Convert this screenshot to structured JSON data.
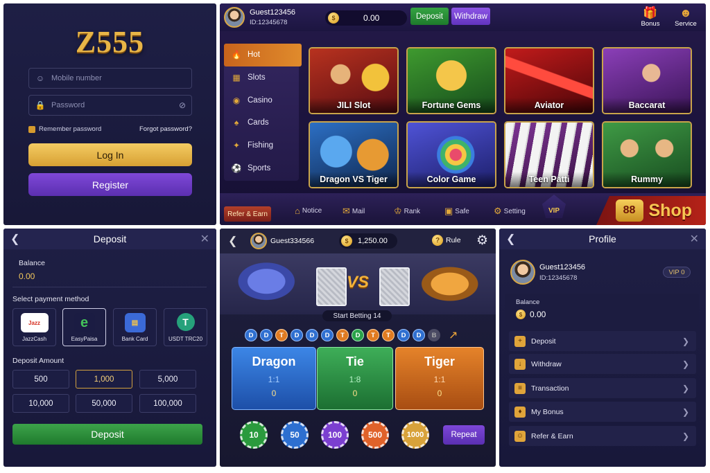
{
  "login": {
    "logo": "Z555",
    "mobile_placeholder": "Mobile number",
    "password_placeholder": "Password",
    "remember": "Remember password",
    "forgot": "Forgot password?",
    "login_btn": "Log In",
    "register_btn": "Register"
  },
  "lobby": {
    "user": {
      "name": "Guest123456",
      "id": "ID:12345678"
    },
    "balance": "0.00",
    "deposit_btn": "Deposit",
    "withdraw_btn": "Withdraw",
    "bonus": "Bonus",
    "service": "Service",
    "categories": [
      {
        "label": "Hot",
        "icon": "fire-icon"
      },
      {
        "label": "Slots",
        "icon": "slots-icon"
      },
      {
        "label": "Casino",
        "icon": "casino-icon"
      },
      {
        "label": "Cards",
        "icon": "cards-icon"
      },
      {
        "label": "Fishing",
        "icon": "fishing-icon"
      },
      {
        "label": "Sports",
        "icon": "sports-icon"
      }
    ],
    "games": [
      {
        "label": "JILI Slot",
        "color": "#8a1c1c"
      },
      {
        "label": "Fortune Gems",
        "color": "#2c6f2a"
      },
      {
        "label": "Aviator",
        "color": "#9c1313"
      },
      {
        "label": "Baccarat",
        "color": "#5b2a86"
      },
      {
        "label": "Dragon VS Tiger",
        "color": "#1f5fa5"
      },
      {
        "label": "Color Game",
        "color": "#3b3fa8"
      },
      {
        "label": "Teen Patti",
        "color": "#6b2a78"
      },
      {
        "label": "Rummy",
        "color": "#2e7a3a"
      }
    ],
    "bottom": {
      "refer": "Refer & Earn",
      "notice": "Notice",
      "mail": "Mail",
      "rank": "Rank",
      "safe": "Safe",
      "setting": "Setting",
      "vip": "VIP",
      "shop": "Shop",
      "shop_badge": "88"
    }
  },
  "deposit": {
    "title": "Deposit",
    "balance_label": "Balance",
    "balance": "0.00",
    "method_label": "Select payment method",
    "methods": [
      "JazzCash",
      "EasyPaisa",
      "Bank Card",
      "USDT TRC20"
    ],
    "amount_label": "Deposit Amount",
    "amounts": [
      "500",
      "1,000",
      "5,000",
      "10,000",
      "50,000",
      "100,000"
    ],
    "selected_amount": "1,000",
    "deposit_btn": "Deposit"
  },
  "game": {
    "user": "Guest334566",
    "balance": "1,250.00",
    "rule": "Rule",
    "vs": "VS",
    "start_betting": "Start Betting 14",
    "road": [
      "D",
      "D",
      "T",
      "D",
      "D",
      "D",
      "T",
      "D",
      "T",
      "T",
      "D",
      "D",
      "B"
    ],
    "bets": [
      {
        "name": "Dragon",
        "odds": "1:1",
        "amount": "0"
      },
      {
        "name": "Tie",
        "odds": "1:8",
        "amount": "0"
      },
      {
        "name": "Tiger",
        "odds": "1:1",
        "amount": "0"
      }
    ],
    "chips": [
      "10",
      "50",
      "100",
      "500",
      "1000"
    ],
    "repeat": "Repeat"
  },
  "profile": {
    "title": "Profile",
    "name": "Guest123456",
    "id": "ID:12345678",
    "vip": "VIP 0",
    "balance_label": "Balance",
    "balance": "0.00",
    "menu": [
      {
        "label": "Deposit",
        "icon": "deposit-icon"
      },
      {
        "label": "Withdraw",
        "icon": "withdraw-icon"
      },
      {
        "label": "Transaction",
        "icon": "transaction-icon"
      },
      {
        "label": "My Bonus",
        "icon": "bonus-icon"
      },
      {
        "label": "Refer & Earn",
        "icon": "refer-icon"
      }
    ]
  },
  "colors": {
    "gold": "#e8b547",
    "purple": "#6a3bc4",
    "green": "#2e8e3c",
    "dragon_blue": "#2f6fd0",
    "tie_green": "#2a9a45",
    "tiger_orange": "#e07b22"
  }
}
